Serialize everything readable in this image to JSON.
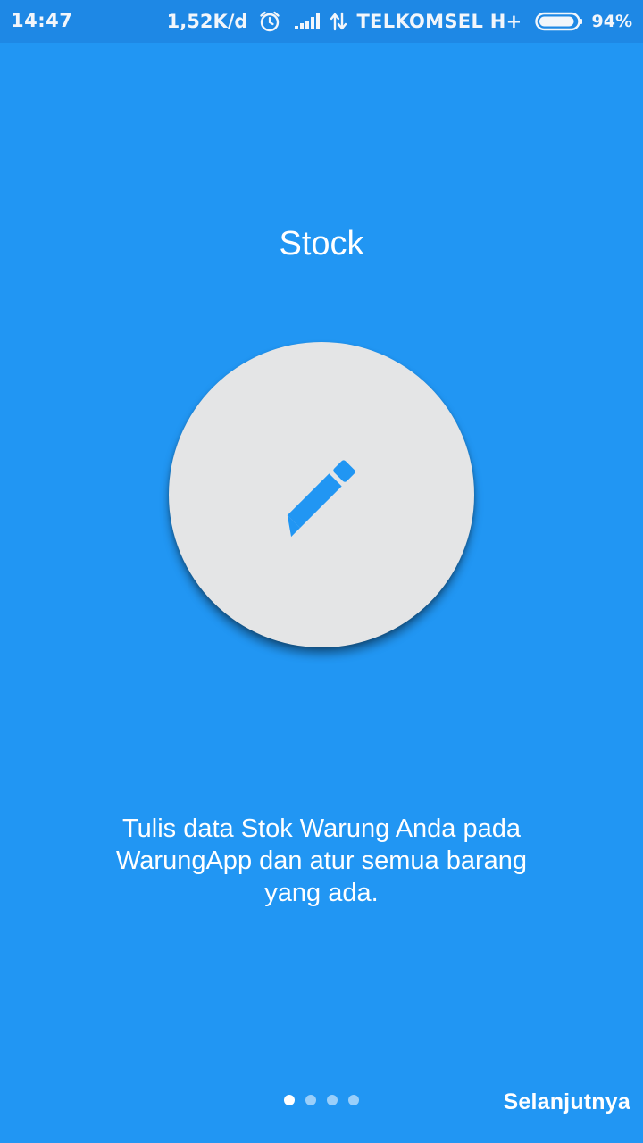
{
  "status_bar": {
    "time": "14:47",
    "network_speed": "1,52K/d",
    "carrier": "TELKOMSEL H+",
    "battery_percent": "94%",
    "battery_level": 0.94,
    "icons": [
      "alarm-icon",
      "signal-icon",
      "data-transfer-icon",
      "battery-icon"
    ]
  },
  "onboarding": {
    "title": "Stock",
    "illustration_icon": "pencil-icon",
    "description": "Tulis data Stok Warung Anda pada WarungApp dan atur semua barang yang ada.",
    "page_count": 4,
    "current_page": 1
  },
  "actions": {
    "next_label": "Selanjutnya"
  },
  "colors": {
    "background": "#2196F3",
    "status_bar": "#1E88E5",
    "circle": "#E4E5E6",
    "icon": "#2196F3",
    "text": "#FFFFFF"
  }
}
